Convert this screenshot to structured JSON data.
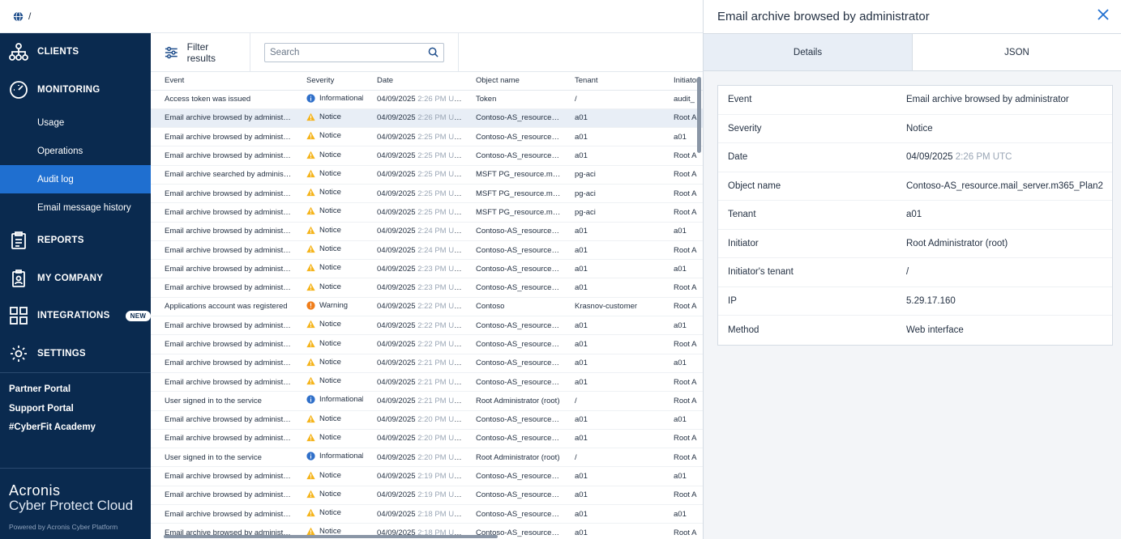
{
  "breadcrumb": "/",
  "sidebar": {
    "items": [
      {
        "label": "CLIENTS"
      },
      {
        "label": "MONITORING"
      },
      {
        "label": "REPORTS"
      },
      {
        "label": "MY COMPANY"
      },
      {
        "label": "INTEGRATIONS",
        "badge": "NEW"
      },
      {
        "label": "SETTINGS"
      }
    ],
    "monitoring_sub": [
      "Usage",
      "Operations",
      "Audit log",
      "Email message history"
    ],
    "links": [
      "Partner Portal",
      "Support Portal",
      "#CyberFit Academy"
    ],
    "brand": {
      "line1": "Acronis",
      "line2": "Cyber Protect Cloud",
      "powered": "Powered by Acronis Cyber Platform"
    }
  },
  "toolbar": {
    "filter_label": "Filter results",
    "search_placeholder": "Search"
  },
  "table": {
    "columns": [
      "Event",
      "Severity",
      "Date",
      "Object name",
      "Tenant",
      "Initiator"
    ],
    "rows": [
      {
        "event": "Access token was issued",
        "severity": "Informational",
        "date": "04/09/2025",
        "time": "2:26 PM UTC",
        "object": "Token",
        "tenant": "/",
        "initiator": "audit_"
      },
      {
        "event": "Email archive browsed by administrator",
        "severity": "Notice",
        "date": "04/09/2025",
        "time": "2:26 PM UTC",
        "object": "Contoso-AS_resource.ma...",
        "tenant": "a01",
        "initiator": "Root A"
      },
      {
        "event": "Email archive browsed by administrator",
        "severity": "Notice",
        "date": "04/09/2025",
        "time": "2:25 PM UTC",
        "object": "Contoso-AS_resource.ma...",
        "tenant": "a01",
        "initiator": "a01"
      },
      {
        "event": "Email archive browsed by administrator",
        "severity": "Notice",
        "date": "04/09/2025",
        "time": "2:25 PM UTC",
        "object": "Contoso-AS_resource.ma...",
        "tenant": "a01",
        "initiator": "Root A"
      },
      {
        "event": "Email archive searched by administrat...",
        "severity": "Notice",
        "date": "04/09/2025",
        "time": "2:25 PM UTC",
        "object": "MSFT PG_resource.mail_s...",
        "tenant": "pg-aci",
        "initiator": "Root A"
      },
      {
        "event": "Email archive browsed by administrator",
        "severity": "Notice",
        "date": "04/09/2025",
        "time": "2:25 PM UTC",
        "object": "MSFT PG_resource.mail_s...",
        "tenant": "pg-aci",
        "initiator": "Root A"
      },
      {
        "event": "Email archive browsed by administrator",
        "severity": "Notice",
        "date": "04/09/2025",
        "time": "2:25 PM UTC",
        "object": "MSFT PG_resource.mail_s...",
        "tenant": "pg-aci",
        "initiator": "Root A"
      },
      {
        "event": "Email archive browsed by administrator",
        "severity": "Notice",
        "date": "04/09/2025",
        "time": "2:24 PM UTC",
        "object": "Contoso-AS_resource.ma...",
        "tenant": "a01",
        "initiator": "a01"
      },
      {
        "event": "Email archive browsed by administrator",
        "severity": "Notice",
        "date": "04/09/2025",
        "time": "2:24 PM UTC",
        "object": "Contoso-AS_resource.ma...",
        "tenant": "a01",
        "initiator": "Root A"
      },
      {
        "event": "Email archive browsed by administrator",
        "severity": "Notice",
        "date": "04/09/2025",
        "time": "2:23 PM UTC",
        "object": "Contoso-AS_resource.ma...",
        "tenant": "a01",
        "initiator": "a01"
      },
      {
        "event": "Email archive browsed by administrator",
        "severity": "Notice",
        "date": "04/09/2025",
        "time": "2:23 PM UTC",
        "object": "Contoso-AS_resource.ma...",
        "tenant": "a01",
        "initiator": "Root A"
      },
      {
        "event": "Applications account was registered",
        "severity": "Warning",
        "date": "04/09/2025",
        "time": "2:22 PM UTC",
        "object": "Contoso",
        "tenant": "Krasnov-customer",
        "initiator": "Root A"
      },
      {
        "event": "Email archive browsed by administrator",
        "severity": "Notice",
        "date": "04/09/2025",
        "time": "2:22 PM UTC",
        "object": "Contoso-AS_resource.ma...",
        "tenant": "a01",
        "initiator": "a01"
      },
      {
        "event": "Email archive browsed by administrator",
        "severity": "Notice",
        "date": "04/09/2025",
        "time": "2:22 PM UTC",
        "object": "Contoso-AS_resource.ma...",
        "tenant": "a01",
        "initiator": "Root A"
      },
      {
        "event": "Email archive browsed by administrator",
        "severity": "Notice",
        "date": "04/09/2025",
        "time": "2:21 PM UTC",
        "object": "Contoso-AS_resource.ma...",
        "tenant": "a01",
        "initiator": "a01"
      },
      {
        "event": "Email archive browsed by administrator",
        "severity": "Notice",
        "date": "04/09/2025",
        "time": "2:21 PM UTC",
        "object": "Contoso-AS_resource.ma...",
        "tenant": "a01",
        "initiator": "Root A"
      },
      {
        "event": "User signed in to the service",
        "severity": "Informational",
        "date": "04/09/2025",
        "time": "2:21 PM UTC",
        "object": "Root Administrator (root)",
        "tenant": "/",
        "initiator": "Root A"
      },
      {
        "event": "Email archive browsed by administrator",
        "severity": "Notice",
        "date": "04/09/2025",
        "time": "2:20 PM UTC",
        "object": "Contoso-AS_resource.ma...",
        "tenant": "a01",
        "initiator": "a01"
      },
      {
        "event": "Email archive browsed by administrator",
        "severity": "Notice",
        "date": "04/09/2025",
        "time": "2:20 PM UTC",
        "object": "Contoso-AS_resource.ma...",
        "tenant": "a01",
        "initiator": "Root A"
      },
      {
        "event": "User signed in to the service",
        "severity": "Informational",
        "date": "04/09/2025",
        "time": "2:20 PM UTC",
        "object": "Root Administrator (root)",
        "tenant": "/",
        "initiator": "Root A"
      },
      {
        "event": "Email archive browsed by administrator",
        "severity": "Notice",
        "date": "04/09/2025",
        "time": "2:19 PM UTC",
        "object": "Contoso-AS_resource.ma...",
        "tenant": "a01",
        "initiator": "a01"
      },
      {
        "event": "Email archive browsed by administrator",
        "severity": "Notice",
        "date": "04/09/2025",
        "time": "2:19 PM UTC",
        "object": "Contoso-AS_resource.ma...",
        "tenant": "a01",
        "initiator": "Root A"
      },
      {
        "event": "Email archive browsed by administrator",
        "severity": "Notice",
        "date": "04/09/2025",
        "time": "2:18 PM UTC",
        "object": "Contoso-AS_resource.ma...",
        "tenant": "a01",
        "initiator": "a01"
      },
      {
        "event": "Email archive browsed by administrator",
        "severity": "Notice",
        "date": "04/09/2025",
        "time": "2:18 PM UTC",
        "object": "Contoso-AS_resource.ma...",
        "tenant": "a01",
        "initiator": "Root A"
      }
    ]
  },
  "panel": {
    "title": "Email archive browsed by administrator",
    "tabs": [
      "Details",
      "JSON"
    ],
    "details": [
      {
        "label": "Event",
        "value": "Email archive browsed by administrator"
      },
      {
        "label": "Severity",
        "value": "Notice"
      },
      {
        "label": "Date",
        "value": "04/09/2025",
        "extra": "2:26 PM UTC"
      },
      {
        "label": "Object name",
        "value": "Contoso-AS_resource.mail_server.m365_Plan2"
      },
      {
        "label": "Tenant",
        "value": "a01"
      },
      {
        "label": "Initiator",
        "value": "Root Administrator (root)"
      },
      {
        "label": "Initiator's tenant",
        "value": "/"
      },
      {
        "label": "IP",
        "value": "5.29.17.160"
      },
      {
        "label": "Method",
        "value": "Web interface"
      }
    ]
  },
  "colors": {
    "sidebar": "#0a2a4f",
    "active": "#1f6fd0",
    "notice": "#f5b41b",
    "warning": "#f07d1a",
    "info": "#2f6fc9"
  }
}
